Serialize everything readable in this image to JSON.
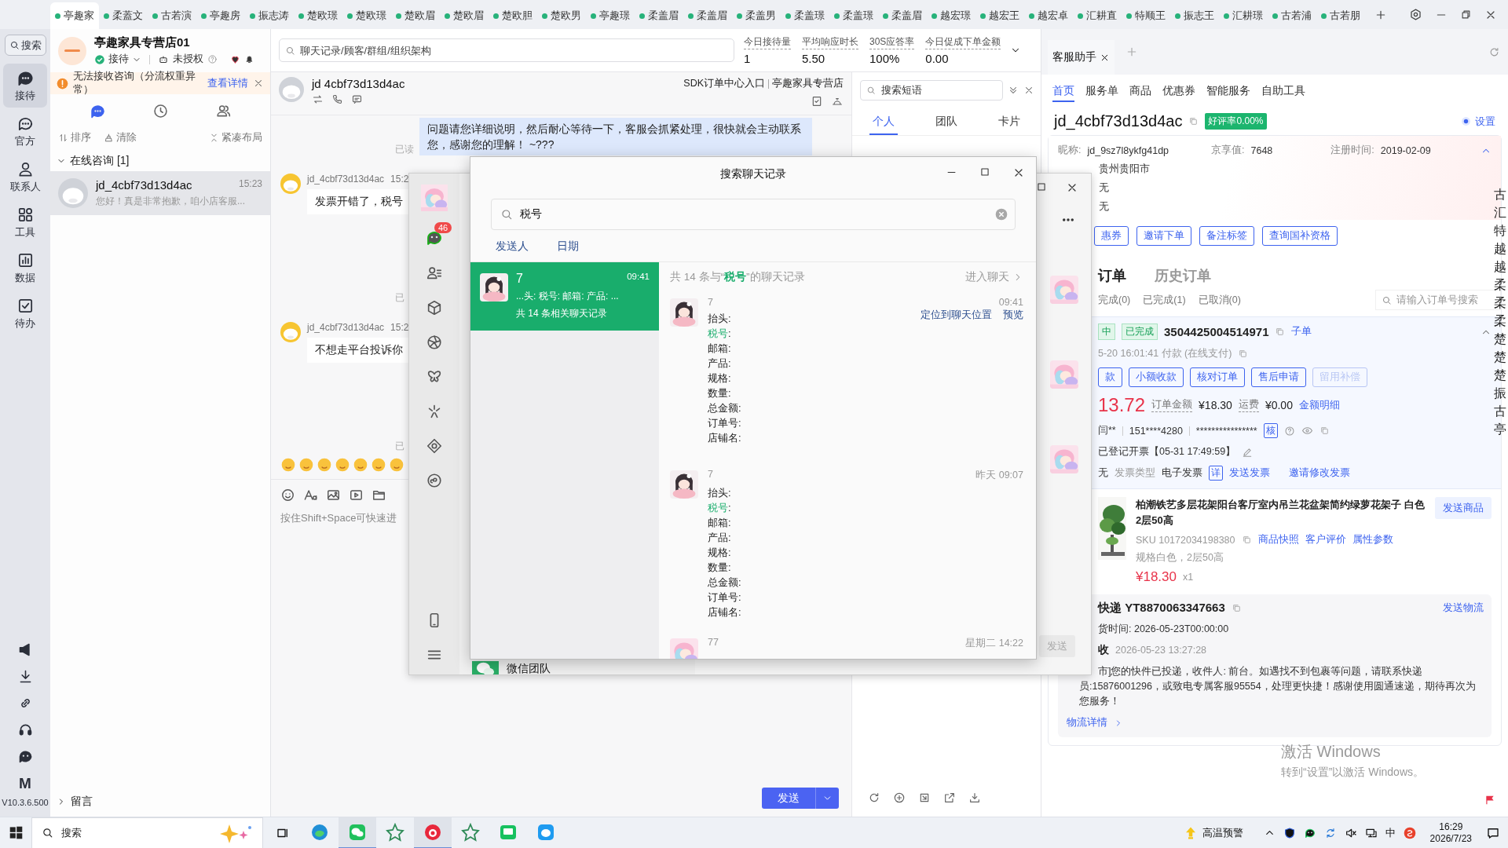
{
  "top_tabs": [
    {
      "label": "亭趣家",
      "selected": true
    },
    {
      "label": "柔蓋文",
      "selected": false
    },
    {
      "label": "古若演",
      "selected": false
    },
    {
      "label": "亭趣房",
      "selected": false
    },
    {
      "label": "振志涛",
      "selected": false
    },
    {
      "label": "楚欧璟",
      "selected": false
    },
    {
      "label": "楚欧璟",
      "selected": false
    },
    {
      "label": "楚欧眉",
      "selected": false
    },
    {
      "label": "楚欧眉",
      "selected": false
    },
    {
      "label": "楚欧胆",
      "selected": false
    },
    {
      "label": "楚欧男",
      "selected": false
    },
    {
      "label": "亭趣璟",
      "selected": false
    },
    {
      "label": "柔盖眉",
      "selected": false
    },
    {
      "label": "柔盖眉",
      "selected": false
    },
    {
      "label": "柔盖男",
      "selected": false
    },
    {
      "label": "柔盖璟",
      "selected": false
    },
    {
      "label": "柔盖璟",
      "selected": false
    },
    {
      "label": "柔盖眉",
      "selected": false
    },
    {
      "label": "越宏璟",
      "selected": false
    },
    {
      "label": "越宏王",
      "selected": false
    },
    {
      "label": "越宏卓",
      "selected": false
    },
    {
      "label": "汇耕直",
      "selected": false
    },
    {
      "label": "特顺王",
      "selected": false
    },
    {
      "label": "振志王",
      "selected": false
    },
    {
      "label": "汇耕璟",
      "selected": false
    },
    {
      "label": "古若浦",
      "selected": false
    },
    {
      "label": "古若朋",
      "selected": false
    }
  ],
  "nav": {
    "search": "搜索",
    "items": [
      {
        "kind": "reception",
        "label": "接待",
        "selected": true
      },
      {
        "kind": "official",
        "label": "官方",
        "selected": false
      },
      {
        "kind": "contacts",
        "label": "联系人",
        "selected": false
      },
      {
        "kind": "tools",
        "label": "工具",
        "selected": false
      },
      {
        "kind": "data",
        "label": "数据",
        "selected": false
      },
      {
        "kind": "todo",
        "label": "待办",
        "selected": false
      }
    ],
    "logo": "M",
    "version": "V10.3.6.500"
  },
  "shop": {
    "name": "亭趣家具专营店01",
    "status": "接待",
    "auth": "未授权",
    "warning": "无法接收咨询（分流权重异常）",
    "warning_link": "查看详情",
    "view_tabs": [
      {
        "kind": "chat",
        "selected": true
      },
      {
        "kind": "history",
        "selected": false
      },
      {
        "kind": "contacts",
        "selected": false
      }
    ],
    "tools": [
      "排序",
      "清除",
      "紧凑布局"
    ],
    "group": "在线咨询 [1]",
    "conversations": [
      {
        "name": "jd_4cbf73d13d4ac",
        "time": "15:23",
        "preview": "您好！真是非常抱歉，咱小店客服...",
        "selected": true
      }
    ],
    "footer": "留言"
  },
  "chat": {
    "search": {
      "placeholder": "聊天记录/顾客/群组/组织架构"
    },
    "stats": [
      {
        "label": "今日接待量",
        "value": "1"
      },
      {
        "label": "平均响应时长",
        "value": "5.50"
      },
      {
        "label": "30S应答率",
        "value": "100%"
      },
      {
        "label": "今日促成下单金额",
        "value": "0.00"
      }
    ],
    "customer": "jd 4cbf73d13d4ac",
    "links": [
      "SDK订单中心入口",
      "亭趣家具专营店"
    ],
    "messages": [
      {
        "kind": "out",
        "text": "问题请您详细说明，然后耐心等待一下，客服会抓紧处理，很快就会主动联系您，感谢您的理解！ ~???"
      },
      {
        "kind": "read",
        "text": "已读"
      },
      {
        "kind": "in",
        "sender": "jd_4cbf73d13d4ac",
        "time": "15:2",
        "text": "发票开错了，税号"
      },
      {
        "kind": "read",
        "text": "已"
      },
      {
        "kind": "in",
        "sender": "jd_4cbf73d13d4ac",
        "time": "15:2",
        "text": "不想走平台投诉你"
      },
      {
        "kind": "read",
        "text": "已"
      }
    ],
    "input": {
      "placeholder": "按住Shift+Space可快速进"
    },
    "send": "发送"
  },
  "phrases": {
    "search": {
      "placeholder": "搜索短语"
    },
    "tabs": [
      {
        "label": "个人",
        "selected": true
      },
      {
        "label": "团队",
        "selected": false
      },
      {
        "label": "卡片",
        "selected": false
      }
    ]
  },
  "assistant": {
    "tab": "客服助手",
    "nav": [
      {
        "label": "首页",
        "selected": true
      },
      {
        "label": "服务单",
        "selected": false
      },
      {
        "label": "商品",
        "selected": false
      },
      {
        "label": "优惠券",
        "selected": false
      },
      {
        "label": "智能服务",
        "selected": false
      },
      {
        "label": "自助工具",
        "selected": false
      }
    ],
    "customer": "jd_4cbf73d13d4ac",
    "rating": "好评率0.00%",
    "settings": "设置",
    "info": [
      {
        "label": "昵称:",
        "value": "jd_9sz7l8ykfg41dp"
      },
      {
        "label": "京享值:",
        "value": "7648"
      },
      {
        "label": "注册时间:",
        "value": "2019-02-09"
      }
    ],
    "region": "贵州贵阳市",
    "extra": [
      "无",
      "无"
    ],
    "actions": [
      "惠券",
      "邀请下单",
      "备注标签",
      "查询国补资格"
    ],
    "order_tabs": [
      {
        "label": "订单",
        "selected": true
      },
      {
        "label": "历史订单",
        "selected": false
      }
    ],
    "order_filters": [
      "完成(0)",
      "已完成(1)",
      "已取消(0)"
    ],
    "order_search": {
      "placeholder": "请输入订单号搜索"
    },
    "order": {
      "tag": "中",
      "status": "已完成",
      "id": "3504425004514971",
      "sub": "子单",
      "paid": "5-20 16:01:41  付款  (在线支付)",
      "buttons": [
        {
          "label": "款",
          "disabled": false
        },
        {
          "label": "小额收款",
          "disabled": false
        },
        {
          "label": "核对订单",
          "disabled": false
        },
        {
          "label": "售后申请",
          "disabled": false
        },
        {
          "label": "留用补偿",
          "disabled": true
        }
      ],
      "amount": "13.72",
      "total_label": "订单金额",
      "total": "¥18.30",
      "freight_label": "运费",
      "freight": "¥0.00",
      "detail": "金额明细",
      "buyer": "闫**",
      "phone": "151****4280",
      "address": "****************",
      "verify": "核",
      "invoice_status": "已登记开票【05-31 17:49:59】",
      "invoice_title": "无",
      "invoice_type_label": "发票类型",
      "invoice_type": "电子发票",
      "invoice_detail": "详",
      "send_invoice": "发送发票",
      "modify_invoice": "邀请修改发票"
    },
    "product": {
      "title": "柏潮铁艺多层花架阳台客厅室内吊兰花盆架简约绿萝花架子 白色 2层50高",
      "send": "发送商品",
      "sku": "SKU 10172034198380",
      "links": [
        "商品快照",
        "客户评价",
        "属性参数"
      ],
      "spec": "规格白色，2层50高",
      "price": "¥18.30",
      "qty": "x1"
    },
    "shipping": {
      "carrier": "快递 YT8870063347663",
      "send": "发送物流",
      "ship_time": "货时间:  2026-05-23T00:00:00",
      "status": "收",
      "status_time": "2026-05-23 13:27:28",
      "message": "市]您的快件已投递，收件人: 前台。如遇找不到包裹等问题，请联系快递员:15876001296，或致电专属客服95554，处理更快捷！感谢使用圆通速递，期待再次为您服务！",
      "details": "物流详情"
    }
  },
  "side_list": [
    "古",
    "汇",
    "特",
    "越",
    "越",
    "柔",
    "柔",
    "柔",
    "楚",
    "楚",
    "楚",
    "振",
    "古",
    "亭"
  ],
  "wechat": {
    "badge": "46",
    "contact": "微信团队",
    "send": "发送"
  },
  "dialog": {
    "title": "搜索聊天记录",
    "query": "税号",
    "filters": [
      "发送人",
      "日期"
    ],
    "conversations": [
      {
        "name": "7",
        "time": "09:41",
        "snippet": "...头:  税号:  邮箱:  产品:  ...",
        "count": "共 14 条相关聊天记录",
        "selected": true
      }
    ],
    "summary": {
      "before": "共 14 条与“",
      "keyword": "税号",
      "after": "”的聊天记录"
    },
    "open_chat": "进入聊天",
    "results": [
      {
        "name": "7",
        "time": "09:41",
        "actions": [
          "定位到聊天位置",
          "预览"
        ],
        "fields": [
          {
            "label": "抬头",
            "sep": ":",
            "highlight": false
          },
          {
            "label": "税号",
            "sep": ":",
            "highlight": true
          },
          {
            "label": "邮箱",
            "sep": ":",
            "highlight": false
          },
          {
            "label": "产品",
            "sep": ":",
            "highlight": false
          },
          {
            "label": "规格",
            "sep": ":",
            "highlight": false
          },
          {
            "label": "数量",
            "sep": ":",
            "highlight": false
          },
          {
            "label": "总金额",
            "sep": ":",
            "highlight": false
          },
          {
            "label": "订单号",
            "sep": ":",
            "highlight": false
          },
          {
            "label": "店铺名",
            "sep": ":",
            "highlight": false
          }
        ]
      },
      {
        "name": "7",
        "time": "昨天 09:07",
        "fields": [
          {
            "label": "抬头",
            "sep": ":",
            "highlight": false
          },
          {
            "label": "税号",
            "sep": ":",
            "highlight": true
          },
          {
            "label": "邮箱",
            "sep": ":",
            "highlight": false
          },
          {
            "label": "产品",
            "sep": ":",
            "highlight": false
          },
          {
            "label": "规格",
            "sep": ":",
            "highlight": false
          },
          {
            "label": "数量",
            "sep": ":",
            "highlight": false
          },
          {
            "label": "总金额",
            "sep": ":",
            "highlight": false
          },
          {
            "label": "订单号",
            "sep": ":",
            "highlight": false
          },
          {
            "label": "店铺名",
            "sep": ":",
            "highlight": false
          }
        ]
      },
      {
        "name": "77",
        "time": "星期二 14:22"
      }
    ]
  },
  "activation": {
    "title": "激活 Windows",
    "hint": "转到“设置”以激活 Windows。"
  },
  "taskbar": {
    "search": "搜索",
    "apps": [
      {
        "kind": "edge",
        "active": false
      },
      {
        "kind": "wechat",
        "active": true
      },
      {
        "kind": "star",
        "active": false
      },
      {
        "kind": "red",
        "active": true
      },
      {
        "kind": "star",
        "active": false
      },
      {
        "kind": "message",
        "active": false
      },
      {
        "kind": "bird",
        "active": false
      }
    ],
    "weather": "高温预警",
    "ime": "中",
    "time": "16:29",
    "date": "2026/7/23"
  }
}
